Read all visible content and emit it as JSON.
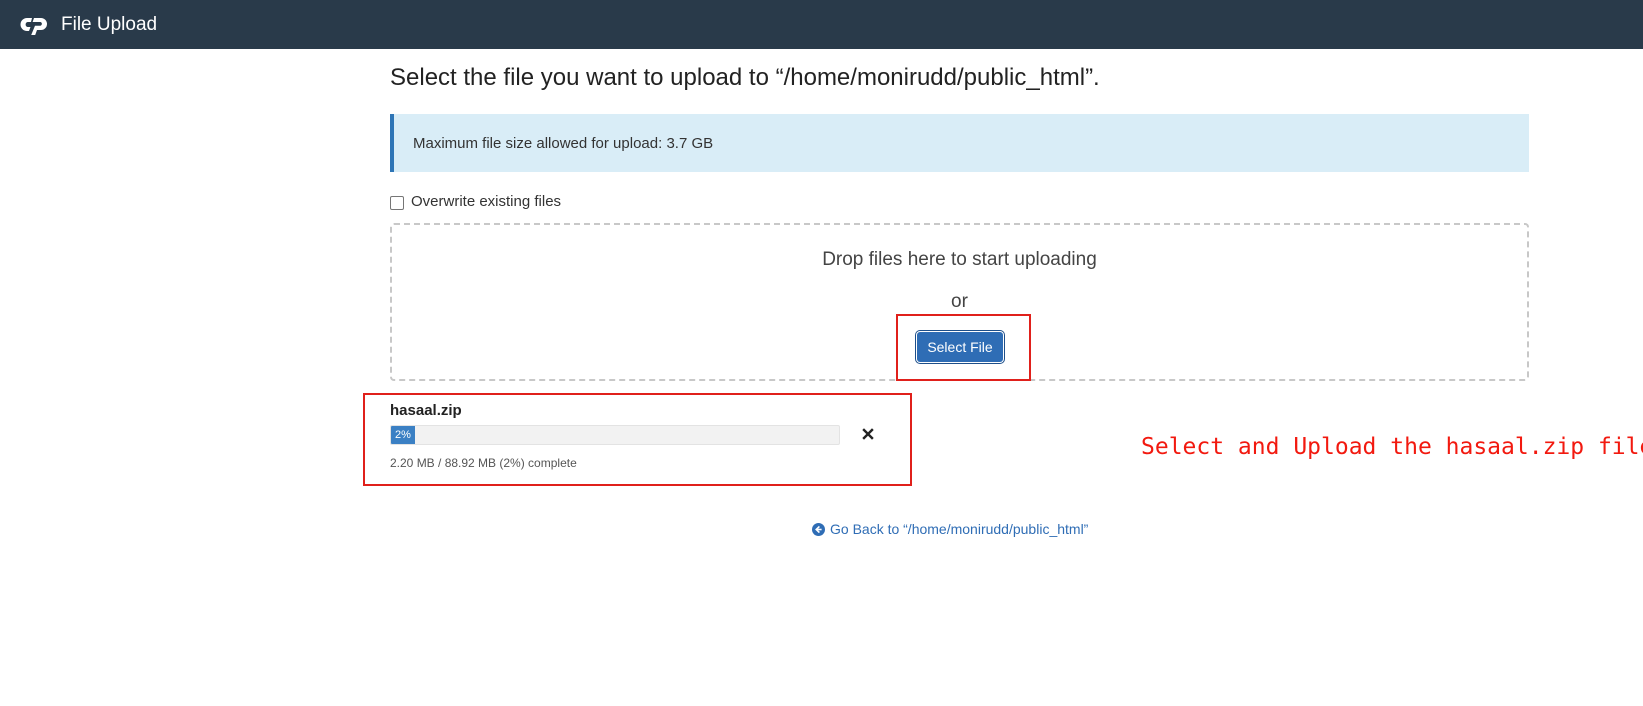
{
  "header": {
    "title": "File Upload",
    "logo_icon": "cpanel-logo-icon",
    "background_color": "#293a4a"
  },
  "main": {
    "heading": "Select the file you want to upload to “/home/monirudd/public_html”.",
    "info": {
      "text": "Maximum file size allowed for upload: 3.7 GB"
    },
    "overwrite": {
      "label": "Overwrite existing files",
      "checked": false
    },
    "dropzone": {
      "drop_text": "Drop files here to start uploading",
      "or_text": "or",
      "select_button_label": "Select File"
    },
    "upload": {
      "file_name": "hasaal.zip",
      "progress_label": "2%",
      "progress_percent": 2,
      "status_text": "2.20 MB / 88.92 MB (2%) complete",
      "cancel_icon": "close-icon"
    },
    "back_link": {
      "label": "Go Back to “/home/monirudd/public_html”",
      "icon": "arrow-circle-left-icon"
    }
  },
  "annotation": {
    "text": "Select and Upload the hasaal.zip file",
    "color": "#f2190f"
  },
  "colors": {
    "accent": "#2f6db5",
    "info_background": "#d9edf7",
    "highlight": "#e0201b"
  }
}
